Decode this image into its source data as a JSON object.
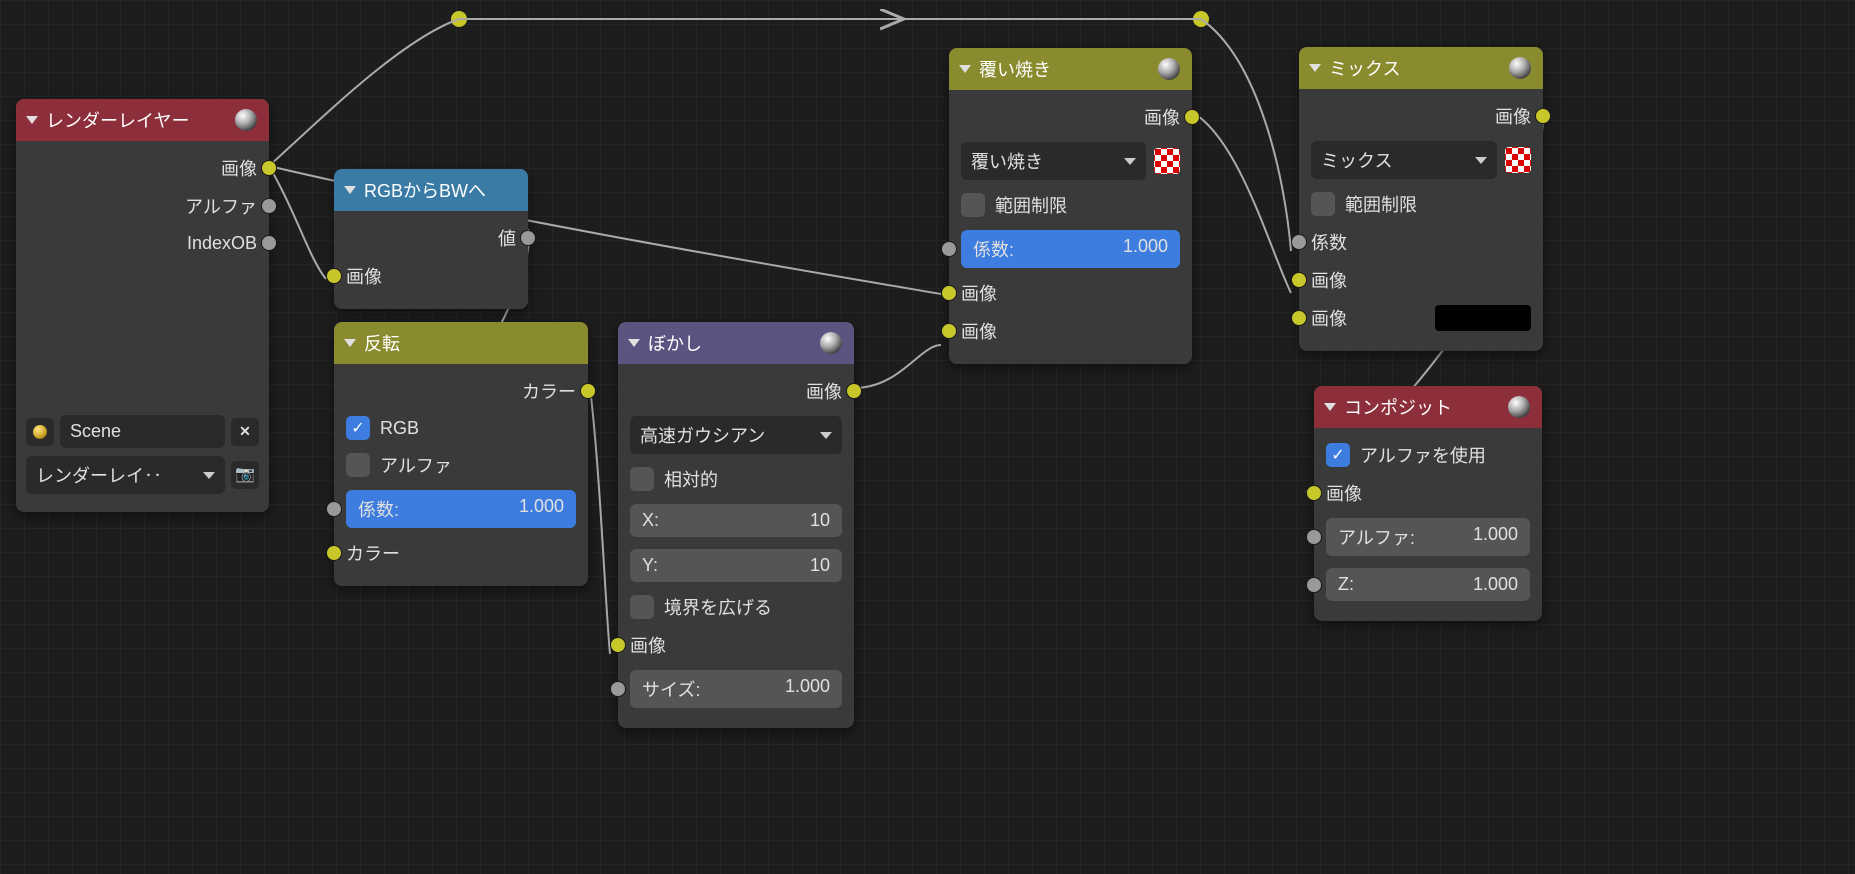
{
  "nodes": {
    "render_layers": {
      "title": "レンダーレイヤー",
      "out_image": "画像",
      "out_alpha": "アルファ",
      "out_indexob": "IndexOB",
      "scene": "Scene",
      "render_layer": "レンダーレイ‥"
    },
    "rgb_to_bw": {
      "title": "RGBからBWへ",
      "out_val": "値",
      "in_image": "画像"
    },
    "invert": {
      "title": "反転",
      "out_color": "カラー",
      "cb_rgb": "RGB",
      "cb_alpha": "アルファ",
      "fac_label": "係数:",
      "fac_value": "1.000",
      "in_color": "カラー"
    },
    "blur": {
      "title": "ぼかし",
      "out_image": "画像",
      "method": "高速ガウシアン",
      "cb_relative": "相対的",
      "x_label": "X:",
      "x_value": "10",
      "y_label": "Y:",
      "y_value": "10",
      "cb_extend": "境界を広げる",
      "in_image": "画像",
      "size_label": "サイズ:",
      "size_value": "1.000"
    },
    "dodge": {
      "title": "覆い焼き",
      "out_image": "画像",
      "mode": "覆い焼き",
      "cb_clamp": "範囲制限",
      "fac_label": "係数:",
      "fac_value": "1.000",
      "in_image1": "画像",
      "in_image2": "画像"
    },
    "mix": {
      "title": "ミックス",
      "out_image": "画像",
      "mode": "ミックス",
      "cb_clamp": "範囲制限",
      "in_fac": "係数",
      "in_image1": "画像",
      "in_image2": "画像"
    },
    "composite": {
      "title": "コンポジット",
      "cb_use_alpha": "アルファを使用",
      "in_image": "画像",
      "alpha_label": "アルファ:",
      "alpha_value": "1.000",
      "z_label": "Z:",
      "z_value": "1.000"
    }
  }
}
